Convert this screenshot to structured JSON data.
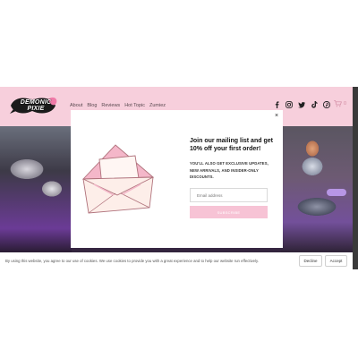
{
  "brand": {
    "logo_text": "DEMONIC\nPIXIE"
  },
  "nav": {
    "items": [
      "About",
      "Blog",
      "Reviews",
      "Hot Topic",
      "Zumiez"
    ]
  },
  "social": {
    "icons": [
      "facebook-icon",
      "instagram-icon",
      "twitter-icon",
      "tiktok-icon",
      "pinterest-icon"
    ]
  },
  "cart": {
    "count": "0"
  },
  "modal": {
    "close_symbol": "×",
    "title": "Join our mailing list and get 10% off your first order!",
    "body": "YOU'LL ALSO GET EXCLUSIVE UPDATES, NEW ARRIVALS, AND INSIDER-ONLY DISCOUNTS.",
    "email_placeholder": "Email address",
    "subscribe_label": "SUBSCRIBE"
  },
  "cookie_bar": {
    "text": "By using this website, you agree to our use of cookies. We use cookies to provide you with a great experience and to help our website run effectively.",
    "decline_label": "Decline",
    "accept_label": "Accept"
  },
  "colors": {
    "header_bg": "#f7cfdc",
    "accent": "#f7c3d5",
    "cart": "#d28aa2"
  }
}
